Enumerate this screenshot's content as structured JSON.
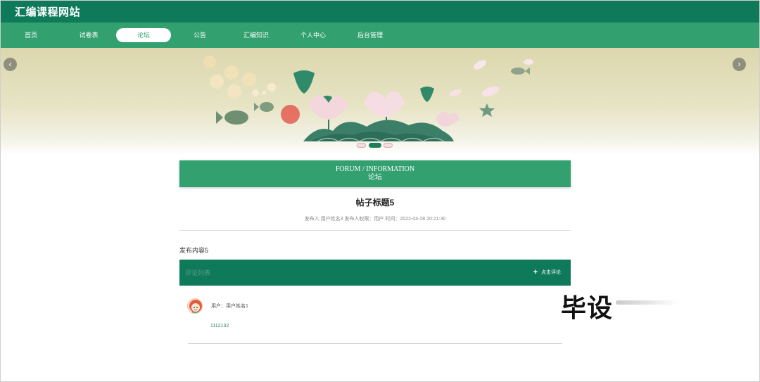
{
  "site": {
    "title": "汇编课程网站"
  },
  "nav": {
    "items": [
      {
        "label": "首页"
      },
      {
        "label": "试卷表"
      },
      {
        "label": "论坛",
        "active": true
      },
      {
        "label": "公告"
      },
      {
        "label": "汇编知识"
      },
      {
        "label": "个人中心"
      },
      {
        "label": "后台管理"
      }
    ]
  },
  "banner": {
    "prev_icon": "chevron-left-icon",
    "next_icon": "chevron-right-icon",
    "slide_count": 3,
    "active_slide": 2
  },
  "forum": {
    "heading_en": "FORUM / INFORMATION",
    "heading_cn": "论坛"
  },
  "post": {
    "title": "帖子标题5",
    "meta": "发布人:用户姓名3   发布人权限：用户   时间：2022-04-28 20:21:30",
    "content": "发布内容5"
  },
  "comments": {
    "bar_label": "评论列表",
    "add_label": "点击评论",
    "items": [
      {
        "user": "用户：用户姓名1",
        "text": "1112132"
      }
    ]
  },
  "watermark": {
    "text": "毕设"
  },
  "colors": {
    "header": "#0f7a5a",
    "nav": "#33a06f",
    "accent": "#1c7e5d"
  }
}
